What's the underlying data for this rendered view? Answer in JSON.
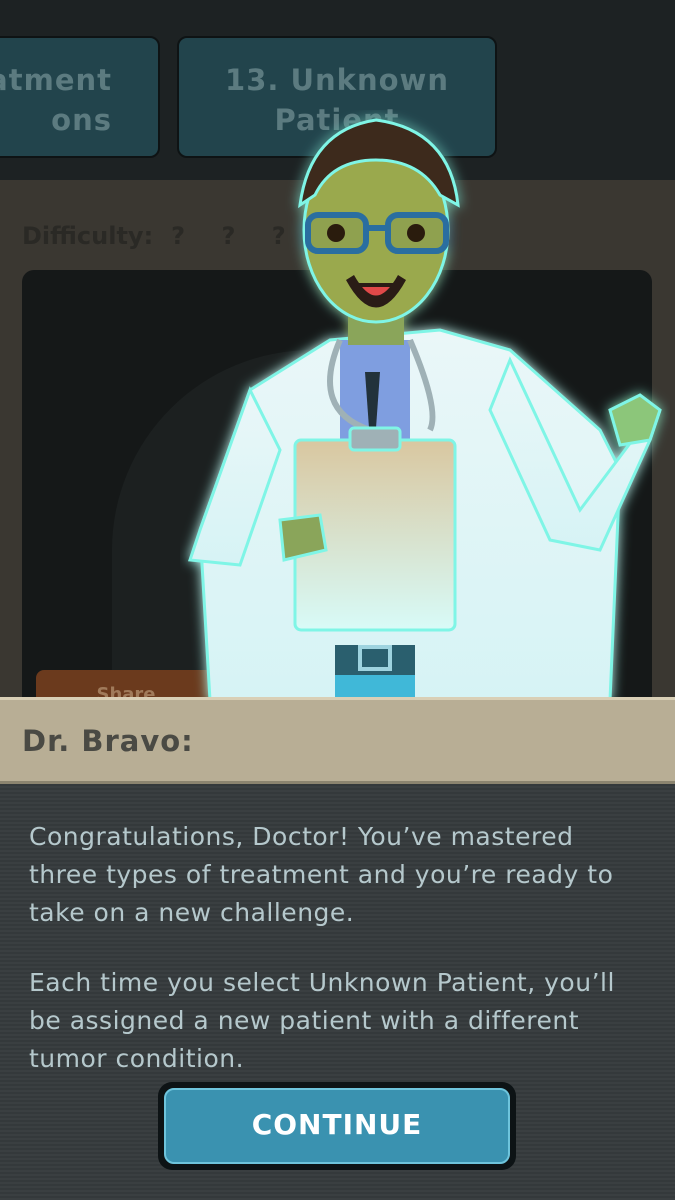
{
  "levels": {
    "left_tile": "atment\nons",
    "right_tile": "13. Unknown\nPatient"
  },
  "difficulty": {
    "label": "Difficulty:",
    "value": "? ? ?"
  },
  "share_button": "Share",
  "dialog": {
    "speaker": "Dr. Bravo:",
    "paragraph1": "Congratulations, Doctor! You’ve mastered three types of treatment and you’re ready to take on a new challenge.",
    "paragraph2": "Each time you select Unknown Patient, you’ll be assigned a new patient with a different tumor condition.",
    "continue_label": "CONTINUE"
  },
  "colors": {
    "tile": "#22444c",
    "name_bar": "#b8ae95",
    "dialog_bg": "#34393b",
    "continue_button": "#3a92b0",
    "hologram_glow": "#7ff5e6"
  }
}
